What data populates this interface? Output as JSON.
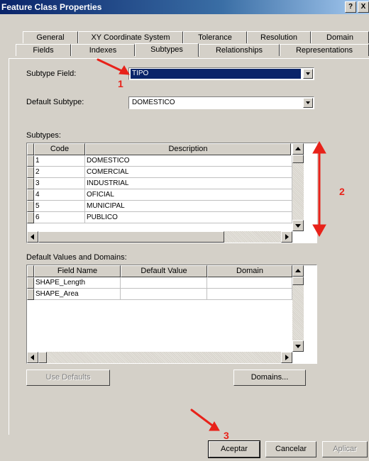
{
  "window": {
    "title": "Feature Class Properties",
    "help_button": "?",
    "close_button": "X"
  },
  "tabs_row1": [
    "General",
    "XY Coordinate System",
    "Tolerance",
    "Resolution",
    "Domain"
  ],
  "tabs_row2": [
    "Fields",
    "Indexes",
    "Subtypes",
    "Relationships",
    "Representations"
  ],
  "active_tab": "Subtypes",
  "subtype_field": {
    "label": "Subtype Field:",
    "value": "TIPO"
  },
  "default_subtype": {
    "label": "Default Subtype:",
    "value": "DOMESTICO"
  },
  "subtypes": {
    "label": "Subtypes:",
    "columns": [
      "Code",
      "Description"
    ],
    "rows": [
      {
        "code": "1",
        "description": "DOMESTICO"
      },
      {
        "code": "2",
        "description": "COMERCIAL"
      },
      {
        "code": "3",
        "description": "INDUSTRIAL"
      },
      {
        "code": "4",
        "description": "OFICIAL"
      },
      {
        "code": "5",
        "description": "MUNICIPAL"
      },
      {
        "code": "6",
        "description": "PUBLICO"
      }
    ]
  },
  "defaults": {
    "label": "Default Values and Domains:",
    "columns": [
      "Field Name",
      "Default Value",
      "Domain"
    ],
    "rows": [
      {
        "field": "SHAPE_Length",
        "default": "",
        "domain": ""
      },
      {
        "field": "SHAPE_Area",
        "default": "",
        "domain": ""
      }
    ]
  },
  "buttons": {
    "use_defaults": "Use Defaults",
    "domains": "Domains...",
    "ok": "Aceptar",
    "cancel": "Cancelar",
    "apply": "Aplicar"
  },
  "annotations": {
    "one": "1",
    "two": "2",
    "three": "3",
    "color": "#e8221a"
  }
}
